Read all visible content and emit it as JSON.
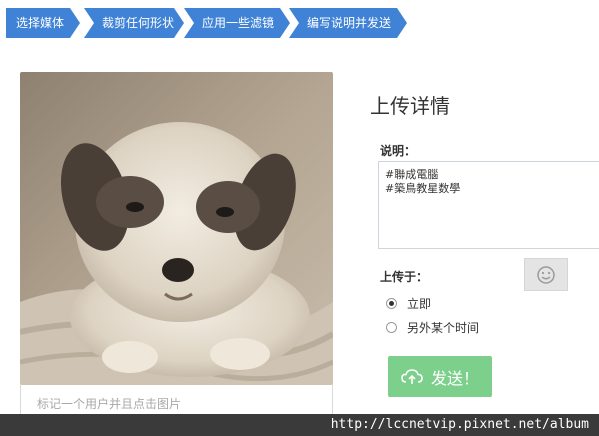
{
  "steps": [
    {
      "label": "选择媒体"
    },
    {
      "label": "裁剪任何形状"
    },
    {
      "label": "应用一些滤镜"
    },
    {
      "label": "编写说明并发送"
    }
  ],
  "photo": {
    "subject": "puppy photo",
    "tag_placeholder": "标记一个用户并且点击图片"
  },
  "details": {
    "title": "上传详情",
    "description_label": "说明：",
    "description_lines": [
      "#聯成電腦",
      "#築鳥教星数學"
    ],
    "emoji_icon": "smiley-icon",
    "upload_label": "上传于：",
    "options": [
      {
        "label": "立即",
        "selected": true
      },
      {
        "label": "另外某个时间",
        "selected": false
      }
    ],
    "send_label": "发送！",
    "send_icon": "cloud-upload-icon"
  },
  "watermark": "http://lccnetvip.pixnet.net/album",
  "colors": {
    "step": "#3f82d6",
    "send": "#7dd08c"
  }
}
